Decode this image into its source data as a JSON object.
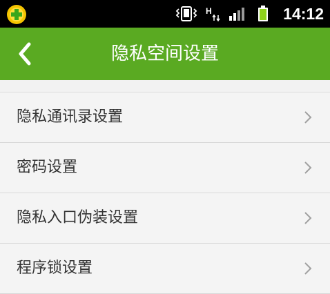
{
  "status_bar": {
    "time": "14:12",
    "icons": [
      "app-badge-icon",
      "vibrate-icon",
      "hplus-data-icon",
      "signal-icon",
      "battery-icon"
    ]
  },
  "header": {
    "title": "隐私空间设置",
    "back_icon": "chevron-left-icon",
    "background_color": "#5aaa22"
  },
  "settings": {
    "items": [
      {
        "label": "隐私通讯录设置"
      },
      {
        "label": "密码设置"
      },
      {
        "label": "隐私入口伪装设置"
      },
      {
        "label": "程序锁设置"
      }
    ],
    "row_icon": "chevron-right-icon"
  }
}
